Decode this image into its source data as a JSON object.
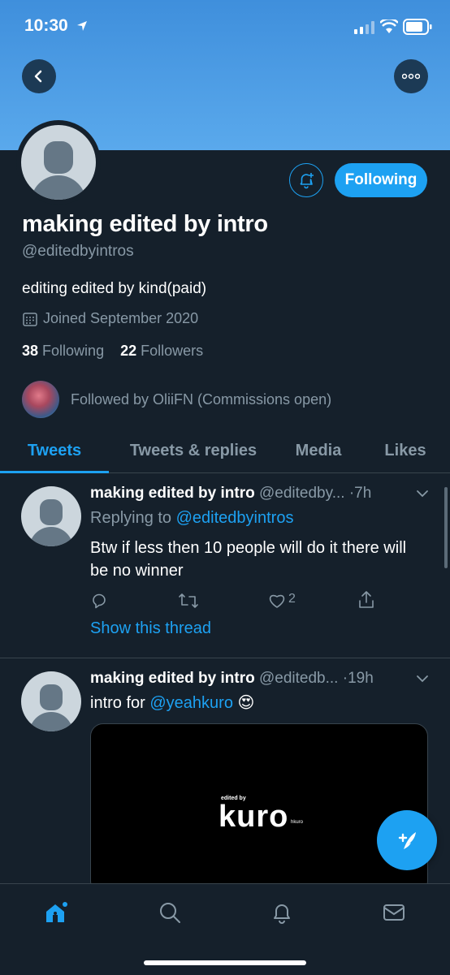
{
  "status_bar": {
    "time": "10:30"
  },
  "profile": {
    "name": "making edited by intro",
    "handle": "@editedbyintros",
    "bio": "editing edited by kind(paid)",
    "joined": "Joined September 2020",
    "following_count": "38",
    "following_label": "Following",
    "followers_count": "22",
    "followers_label": "Followers",
    "followed_by": "Followed by OliiFN (Commissions open)",
    "follow_button_label": "Following"
  },
  "tabs": [
    {
      "label": "Tweets",
      "active": true
    },
    {
      "label": "Tweets & replies",
      "active": false
    },
    {
      "label": "Media",
      "active": false
    },
    {
      "label": "Likes",
      "active": false
    }
  ],
  "tweets": [
    {
      "name": "making edited by intro",
      "handle_truncated": "@editedby...",
      "time": "7h",
      "reply_prefix": "Replying to",
      "reply_to": "@editedbyintros",
      "text": "Btw if less then 10 people will do it there will be no winner",
      "like_count": "2",
      "show_thread": "Show this thread"
    },
    {
      "name": "making edited by intro",
      "handle_truncated": "@editedb...",
      "time": "19h",
      "text_prefix": "intro for",
      "mention": "@yeahkuro",
      "emoji": "😍",
      "media_small_text": "edited by",
      "media_big_text": "kuro",
      "media_tiny_text": "hkuro"
    }
  ],
  "colors": {
    "accent": "#1da1f2",
    "background": "#15202b",
    "muted": "#8899a6",
    "banner": "#4a9be4"
  }
}
